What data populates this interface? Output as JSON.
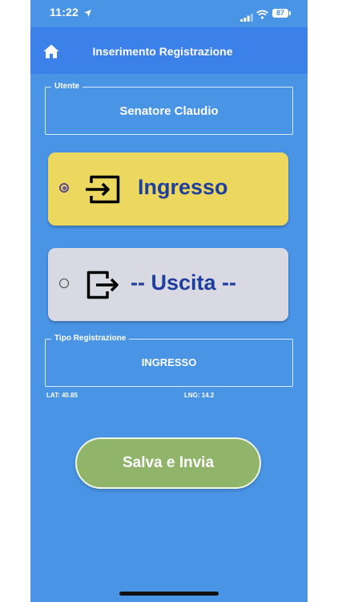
{
  "status_bar": {
    "time": "11:22",
    "battery": "87"
  },
  "header": {
    "title": "Inserimento Registrazione"
  },
  "user_field": {
    "legend": "Utente",
    "value": "Senatore Claudio"
  },
  "entry_button": {
    "label": "Ingresso",
    "selected": true,
    "color": "#ecd85f"
  },
  "exit_button": {
    "label": "-- Uscita --",
    "selected": false,
    "color": "#d9d9e3"
  },
  "type_field": {
    "legend": "Tipo Registrazione",
    "value": "INGRESSO"
  },
  "coords": {
    "lat": "LAT: 40.85",
    "lng": "LNG: 14.2"
  },
  "save_button": {
    "label": "Salva e Invia",
    "color": "#8fb46a"
  },
  "colors": {
    "header": "#3c80ea",
    "background": "#4a94e6",
    "label_text": "#1f3f9c"
  }
}
